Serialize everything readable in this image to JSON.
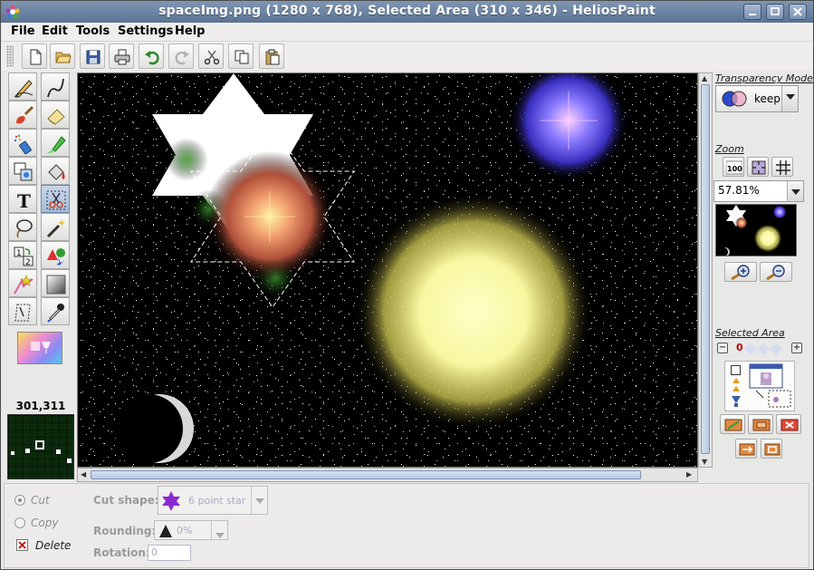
{
  "window": {
    "title": "spaceImg.png (1280 x 768), Selected Area (310 x 346) - HeliosPaint"
  },
  "menu": {
    "items": [
      "File",
      "Edit",
      "Tools",
      "Settings",
      "Help"
    ]
  },
  "toolbar": {
    "buttons": [
      "new-file",
      "open-folder",
      "save",
      "print",
      "undo",
      "redo",
      "cut",
      "copy",
      "paste"
    ]
  },
  "tools": {
    "icons": [
      "pencil",
      "curve-line",
      "brush",
      "eraser",
      "spray-can",
      "highlighter",
      "clone-stamp",
      "fill-bucket",
      "text",
      "selection-cut",
      "lasso",
      "magic-wand",
      "layer-order",
      "shapes",
      "star-gradient",
      "gradient-fill",
      "transform",
      "eyedropper"
    ],
    "text_tool_glyph": "T",
    "layer_tool_labels": [
      "1",
      "2"
    ]
  },
  "status": {
    "cursor_coords": "301,311"
  },
  "transparency": {
    "label": "Transparency Mode",
    "mode": "keep"
  },
  "zoom": {
    "label": "Zoom",
    "button_100": "100",
    "value": "57.81%"
  },
  "selected_area": {
    "label": "Selected Area",
    "level": "0"
  },
  "options": {
    "cut_label": "Cut",
    "copy_label": "Copy",
    "delete_label": "Delete",
    "cut_shape_label": "Cut shape:",
    "cut_shape_value": "6 point star",
    "rounding_label": "Rounding:",
    "rounding_value": "0%",
    "rotation_label": "Rotation:",
    "rotation_value": "0"
  },
  "colors": {
    "titlebar": "#5b7394",
    "accent": "#a6bbd9",
    "canvas_bg": "#000000"
  }
}
